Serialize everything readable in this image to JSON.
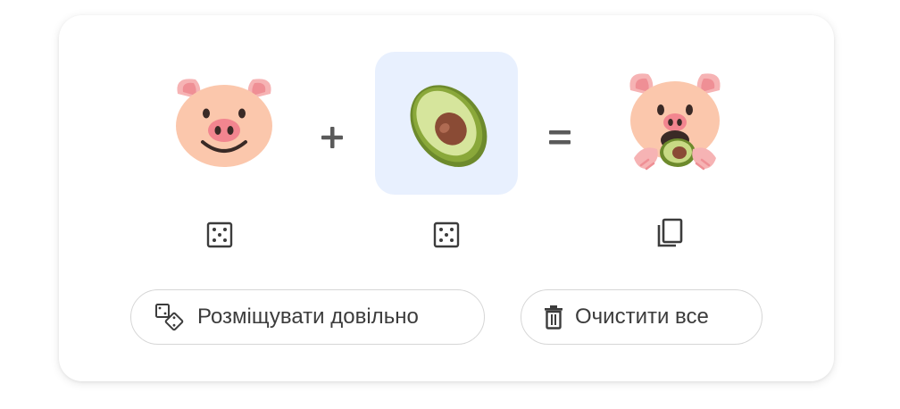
{
  "mixer": {
    "left_emoji": "pig-face",
    "right_emoji": "avocado",
    "result_emoji": "pig-eating-avocado",
    "plus_sign": "+",
    "equals_sign": "="
  },
  "controls": {
    "randomize_left_icon": "dice-icon",
    "randomize_right_icon": "dice-icon",
    "copy_result_icon": "copy-icon"
  },
  "actions": {
    "randomize_label": "Розміщувати довільно",
    "clear_label": "Очистити все"
  },
  "colors": {
    "selected_slot_bg": "#e8f0fe",
    "icon_gray": "#5f6368",
    "pill_border": "#d6d6d6"
  }
}
